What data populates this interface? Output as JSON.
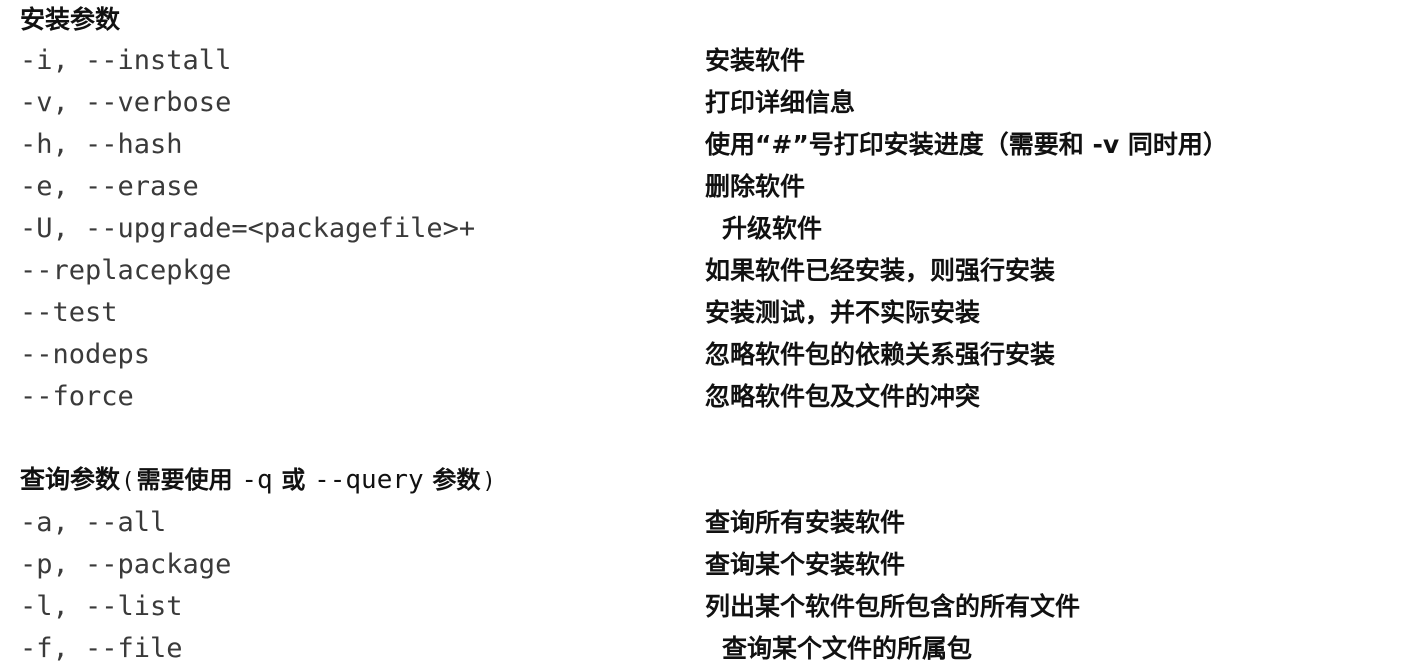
{
  "install_section": {
    "heading": "安装参数",
    "options": [
      {
        "flag": "-i, --install",
        "desc": "安装软件"
      },
      {
        "flag": "-v, --verbose",
        "desc": "打印详细信息"
      },
      {
        "flag": "-h, --hash",
        "desc": "使用“#”号打印安装进度（需要和 -v 同时用）"
      },
      {
        "flag": "-e, --erase",
        "desc": "删除软件"
      },
      {
        "flag": "-U, --upgrade=<packagefile>+",
        "desc": "升级软件"
      },
      {
        "flag": "--replacepkge",
        "desc": "如果软件已经安装，则强行安装"
      },
      {
        "flag": "--test",
        "desc": "安装测试，并不实际安装"
      },
      {
        "flag": "--nodeps",
        "desc": "忽略软件包的依赖关系强行安装"
      },
      {
        "flag": "--force",
        "desc": "忽略软件包及文件的冲突"
      }
    ]
  },
  "query_section": {
    "heading": "查询参数",
    "open_paren": "(",
    "note_before": "需要使用",
    "short_flag": "-q",
    "note_or": "或",
    "long_flag": "--query",
    "note_after": "参数",
    "close_paren": ")",
    "options": [
      {
        "flag": "-a, --all",
        "desc": "查询所有安装软件"
      },
      {
        "flag": "-p, --package",
        "desc": "查询某个安装软件"
      },
      {
        "flag": "-l, --list",
        "desc": "列出某个软件包所包含的所有文件"
      },
      {
        "flag": "-f, --file",
        "desc": "查询某个文件的所属包"
      }
    ]
  }
}
